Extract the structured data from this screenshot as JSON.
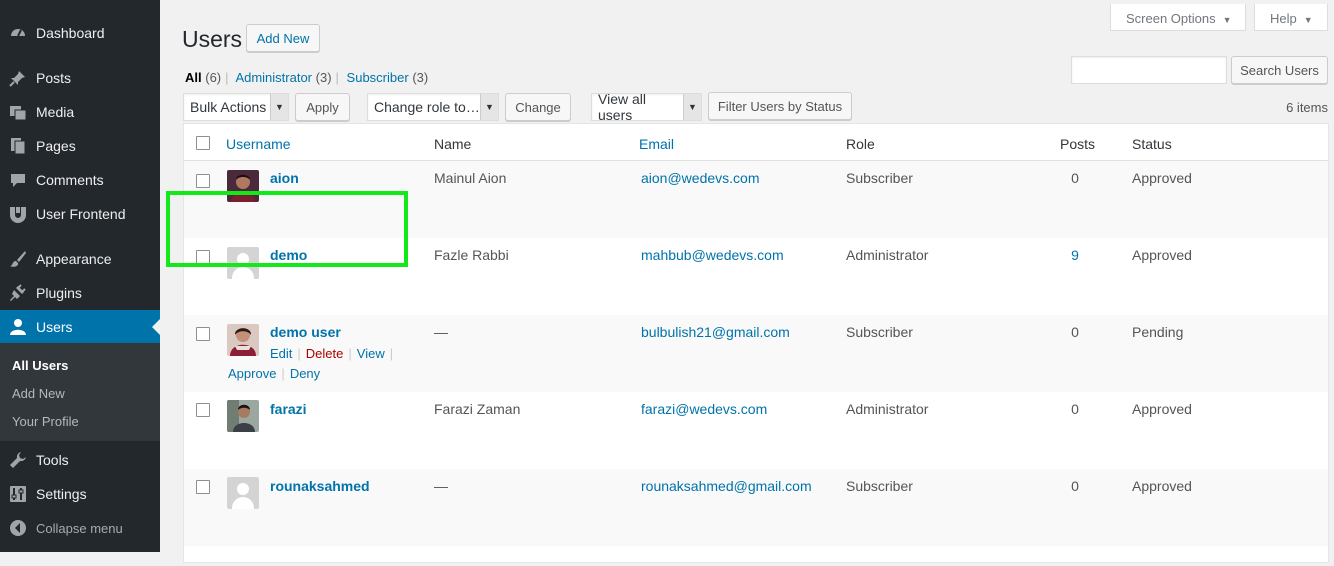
{
  "sidebar": {
    "items": [
      {
        "label": "Dashboard",
        "icon": "dashboard-icon"
      },
      {
        "label": "Posts",
        "icon": "pin-icon"
      },
      {
        "label": "Media",
        "icon": "media-icon"
      },
      {
        "label": "Pages",
        "icon": "pages-icon"
      },
      {
        "label": "Comments",
        "icon": "comment-icon"
      },
      {
        "label": "User Frontend",
        "icon": "user-frontend-icon"
      },
      {
        "label": "Appearance",
        "icon": "paintbrush-icon"
      },
      {
        "label": "Plugins",
        "icon": "plugin-icon"
      },
      {
        "label": "Users",
        "icon": "users-icon"
      },
      {
        "label": "Tools",
        "icon": "wrench-icon"
      },
      {
        "label": "Settings",
        "icon": "settings-icon"
      }
    ],
    "submenu": [
      "All Users",
      "Add New",
      "Your Profile"
    ],
    "collapse_label": "Collapse menu"
  },
  "screen_options": "Screen Options",
  "help": "Help",
  "page_title": "Users",
  "add_new": "Add New",
  "views": {
    "all": "All",
    "all_count": "(6)",
    "administrator": "Administrator",
    "administrator_count": "(3)",
    "subscriber": "Subscriber",
    "subscriber_count": "(3)"
  },
  "bulk_actions": "Bulk Actions",
  "apply": "Apply",
  "change_role": "Change role to…",
  "change": "Change",
  "view_all_users": "View all users",
  "filter_status": "Filter Users by Status",
  "search_button": "Search Users",
  "search_value": "",
  "items_count": "6 items",
  "columns": [
    "Username",
    "Name",
    "Email",
    "Role",
    "Posts",
    "Status"
  ],
  "users": [
    {
      "username": "aion",
      "name": "Mainul Aion",
      "email": "aion@wedevs.com",
      "role": "Subscriber",
      "posts": "0",
      "status": "Approved"
    },
    {
      "username": "demo",
      "name": "Fazle Rabbi",
      "email": "mahbub@wedevs.com",
      "role": "Administrator",
      "posts": "9",
      "status": "Approved"
    },
    {
      "username": "demo user",
      "name": "—",
      "email": "bulbulish21@gmail.com",
      "role": "Subscriber",
      "posts": "0",
      "status": "Pending"
    },
    {
      "username": "farazi",
      "name": "Farazi Zaman",
      "email": "farazi@wedevs.com",
      "role": "Administrator",
      "posts": "0",
      "status": "Approved"
    },
    {
      "username": "rounaksahmed",
      "name": "—",
      "email": "rounaksahmed@gmail.com",
      "role": "Subscriber",
      "posts": "0",
      "status": "Approved"
    }
  ],
  "row_actions": {
    "edit": "Edit",
    "delete": "Delete",
    "view": "View",
    "approve": "Approve",
    "deny": "Deny"
  },
  "colors": {
    "sidebar_bg": "#23282d",
    "accent": "#0073aa",
    "highlight": "#12e81a",
    "delete": "#a00"
  }
}
